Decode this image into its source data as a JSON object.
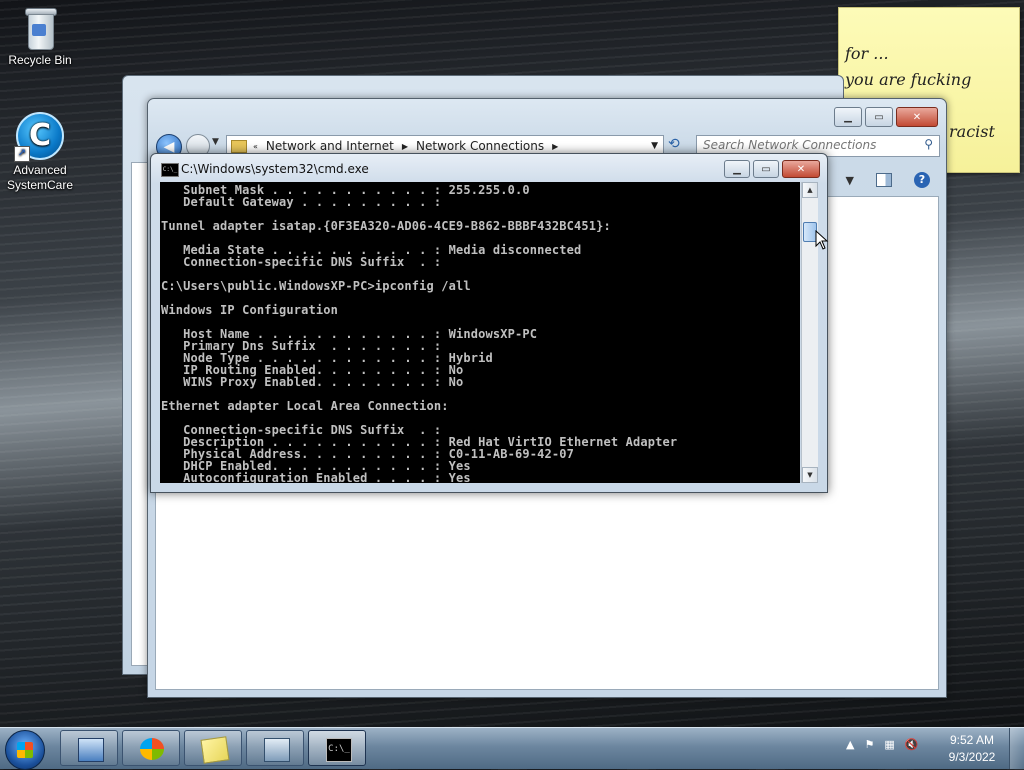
{
  "desktop": {
    "icons": [
      {
        "label": "Recycle Bin"
      },
      {
        "label": "Advanced\nSystemCare"
      }
    ]
  },
  "sticky_note": {
    "lines": [
      "for ...",
      "you are fucking",
      "racist"
    ]
  },
  "explorer": {
    "breadcrumb": [
      "Network and Internet",
      "Network Connections"
    ],
    "search_placeholder": "Search Network Connections"
  },
  "cmd": {
    "title": "C:\\Windows\\system32\\cmd.exe",
    "icon_text": "C:\\_",
    "lines": [
      "   Subnet Mask . . . . . . . . . . . : 255.255.0.0",
      "   Default Gateway . . . . . . . . . :",
      "",
      "Tunnel adapter isatap.{0F3EA320-AD06-4CE9-B862-BBBF432BC451}:",
      "",
      "   Media State . . . . . . . . . . . : Media disconnected",
      "   Connection-specific DNS Suffix  . :",
      "",
      "C:\\Users\\public.WindowsXP-PC>ipconfig /all",
      "",
      "Windows IP Configuration",
      "",
      "   Host Name . . . . . . . . . . . . : WindowsXP-PC",
      "   Primary Dns Suffix  . . . . . . . :",
      "   Node Type . . . . . . . . . . . . : Hybrid",
      "   IP Routing Enabled. . . . . . . . : No",
      "   WINS Proxy Enabled. . . . . . . . : No",
      "",
      "Ethernet adapter Local Area Connection:",
      "",
      "   Connection-specific DNS Suffix  . :",
      "   Description . . . . . . . . . . . : Red Hat VirtIO Ethernet Adapter",
      "   Physical Address. . . . . . . . . : C0-11-AB-69-42-07",
      "   DHCP Enabled. . . . . . . . . . . : Yes",
      "   Autoconfiguration Enabled . . . . : Yes"
    ]
  },
  "taskbar": {
    "clock_time": "9:52 AM",
    "clock_date": "9/3/2022"
  }
}
